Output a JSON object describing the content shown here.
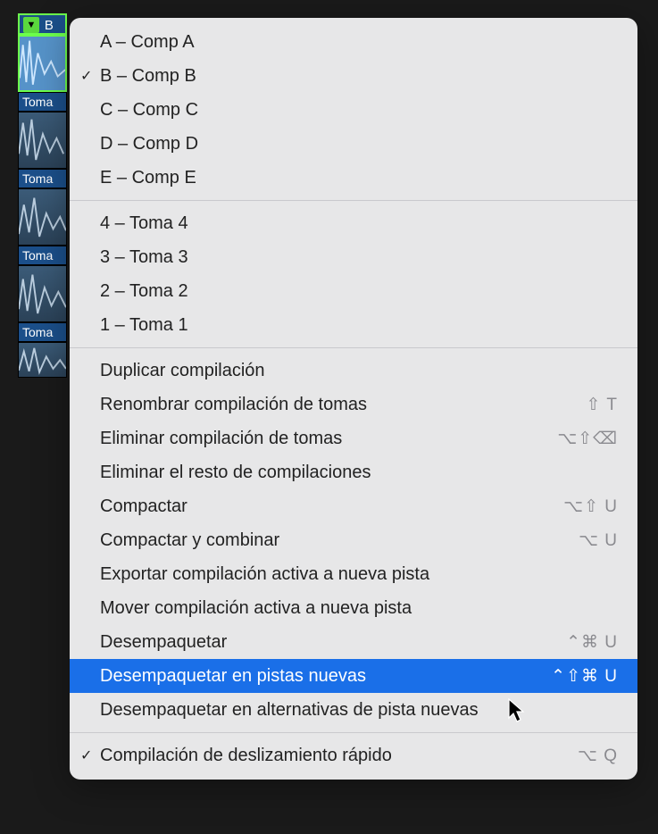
{
  "header": {
    "disclosure_glyph": "▼",
    "label": "B"
  },
  "takes": [
    {
      "label": "Toma"
    },
    {
      "label": "Toma"
    },
    {
      "label": "Toma"
    },
    {
      "label": "Toma"
    }
  ],
  "menu": {
    "comps": [
      {
        "label": "A – Comp A",
        "checked": false
      },
      {
        "label": "B – Comp B",
        "checked": true
      },
      {
        "label": "C – Comp C",
        "checked": false
      },
      {
        "label": "D – Comp D",
        "checked": false
      },
      {
        "label": "E – Comp E",
        "checked": false
      }
    ],
    "take_items": [
      {
        "label": "4 – Toma 4"
      },
      {
        "label": "3 – Toma 3"
      },
      {
        "label": "2 – Toma 2"
      },
      {
        "label": "1 – Toma 1"
      }
    ],
    "actions": [
      {
        "label": "Duplicar compilación",
        "shortcut": ""
      },
      {
        "label": "Renombrar compilación de tomas",
        "shortcut": "⇧ T"
      },
      {
        "label": "Eliminar compilación de tomas",
        "shortcut": "⌥⇧⌫"
      },
      {
        "label": "Eliminar el resto de compilaciones",
        "shortcut": ""
      },
      {
        "label": "Compactar",
        "shortcut": "⌥⇧ U"
      },
      {
        "label": "Compactar y combinar",
        "shortcut": "⌥ U"
      },
      {
        "label": "Exportar compilación activa a nueva pista",
        "shortcut": ""
      },
      {
        "label": "Mover compilación activa a nueva pista",
        "shortcut": ""
      },
      {
        "label": "Desempaquetar",
        "shortcut": "⌃⌘ U"
      },
      {
        "label": "Desempaquetar en pistas nuevas",
        "shortcut": "⌃⇧⌘ U",
        "highlighted": true
      },
      {
        "label": "Desempaquetar en alternativas de pista nuevas",
        "shortcut": ""
      }
    ],
    "footer": [
      {
        "label": "Compilación de deslizamiento rápido",
        "shortcut": "⌥ Q",
        "checked": true
      }
    ]
  }
}
